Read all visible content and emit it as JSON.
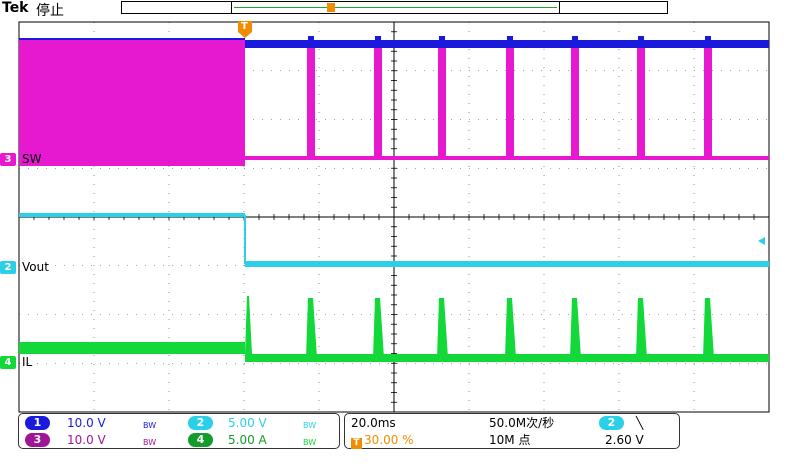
{
  "header": {
    "brand": "Tek",
    "status": "停止",
    "trigger_marker": "T"
  },
  "channels": [
    {
      "num": "1",
      "color": "#1a1adc"
    },
    {
      "num": "2",
      "color": "#2ccfe8",
      "label": "Vout"
    },
    {
      "num": "3",
      "color": "#e619d0",
      "label": "SW"
    },
    {
      "num": "4",
      "color": "#13d83a",
      "label": "IL"
    }
  ],
  "footer": {
    "ch1": {
      "num": "1",
      "scale": "10.0 V",
      "bw": "BW"
    },
    "ch2": {
      "num": "2",
      "scale": "5.00 V",
      "bw": "BW"
    },
    "ch3": {
      "num": "3",
      "scale": "10.0 V",
      "bw": "BW"
    },
    "ch4": {
      "num": "4",
      "scale": "5.00 A",
      "bw": "BW"
    },
    "timebase": "20.0ms",
    "sample_rate": "50.0M次/秒",
    "trigger_pos": "30.00 %",
    "record_length": "10M 点",
    "trig_channel": "2",
    "trig_slope": "╲",
    "trig_level": "2.60 V"
  },
  "colors": {
    "ch1": "#1a1adc",
    "ch2": "#2ccfe8",
    "ch3": "#e619d0",
    "ch4": "#13d83a",
    "trigger": "#f08c00",
    "grid": "#000000"
  }
}
